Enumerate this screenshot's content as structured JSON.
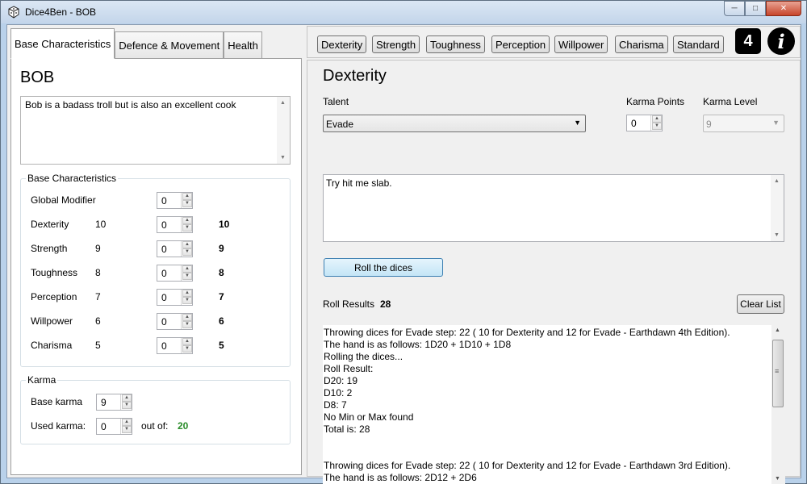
{
  "window": {
    "title": "Dice4Ben - BOB",
    "minimize_icon": "minimize-icon",
    "maximize_icon": "maximize-icon",
    "close_icon": "close-icon"
  },
  "left": {
    "tabs": [
      "Base Characteristics",
      "Defence & Movement",
      "Health"
    ],
    "character_name": "BOB",
    "description": "Bob is a badass troll but is also an excellent cook",
    "base_characteristics": {
      "title": "Base Characteristics",
      "rows": [
        {
          "label": "Global Modifier",
          "base": "",
          "modifier": "0",
          "total": ""
        },
        {
          "label": "Dexterity",
          "base": "10",
          "modifier": "0",
          "total": "10"
        },
        {
          "label": "Strength",
          "base": "9",
          "modifier": "0",
          "total": "9"
        },
        {
          "label": "Toughness",
          "base": "8",
          "modifier": "0",
          "total": "8"
        },
        {
          "label": "Perception",
          "base": "7",
          "modifier": "0",
          "total": "7"
        },
        {
          "label": "Willpower",
          "base": "6",
          "modifier": "0",
          "total": "6"
        },
        {
          "label": "Charisma",
          "base": "5",
          "modifier": "0",
          "total": "5"
        }
      ]
    },
    "karma": {
      "title": "Karma",
      "base_label": "Base karma",
      "base_value": "9",
      "used_label": "Used karma:",
      "used_value": "0",
      "out_of_label": "out of:",
      "out_of_value": "20"
    }
  },
  "toolbar": {
    "buttons": [
      "Dexterity",
      "Strength",
      "Toughness",
      "Perception",
      "Willpower",
      "Charisma",
      "Standard"
    ],
    "edition_badge": "4",
    "info_icon": "info-icon"
  },
  "right": {
    "section_title": "Dexterity",
    "talent_label": "Talent",
    "talent_value": "Evade",
    "karma_points_label": "Karma Points",
    "karma_points_value": "0",
    "karma_level_label": "Karma Level",
    "karma_level_value": "9",
    "note": "Try hit me slab.",
    "roll_button": "Roll the dices",
    "roll_results_label": "Roll Results",
    "roll_results_value": "28",
    "clear_button": "Clear List",
    "results_lines": [
      "Throwing dices for Evade step: 22 ( 10 for Dexterity and 12 for Evade - Earthdawn 4th Edition).",
      "The hand is as follows: 1D20 + 1D10 + 1D8",
      "Rolling the dices...",
      "Roll Result:",
      "D20: 19",
      "D10: 2",
      "D8: 7",
      "No Min or Max found",
      "Total is: 28",
      "",
      "",
      "Throwing dices for Evade step: 22 ( 10 for Dexterity and 12 for Evade - Earthdawn 3rd Edition).",
      "The hand is as follows: 2D12 + 2D6"
    ]
  },
  "colors": {
    "accent_green": "#2a8c2a",
    "window_frame": "#b9d1ea"
  }
}
